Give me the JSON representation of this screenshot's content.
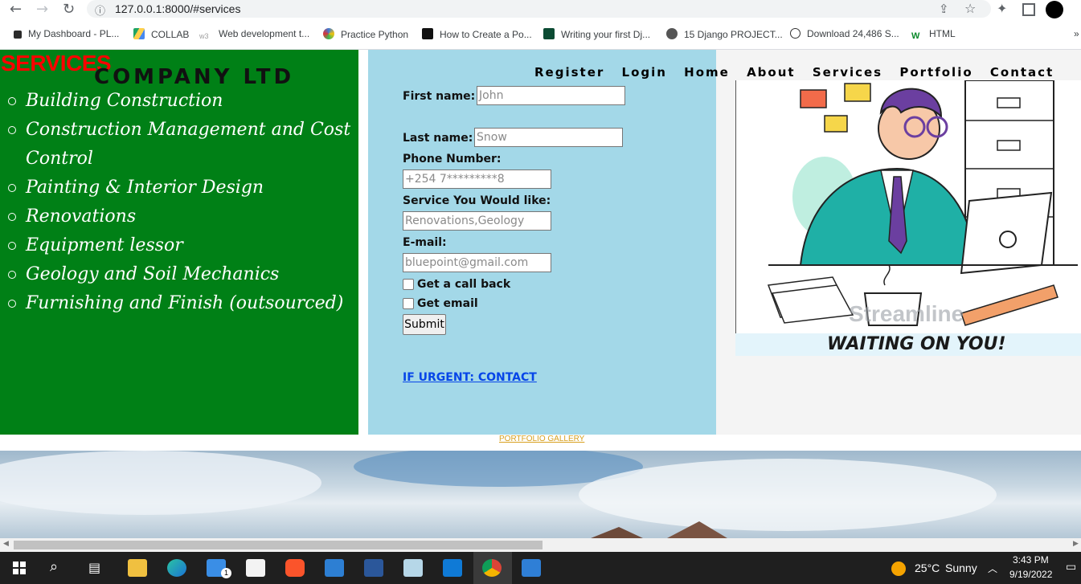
{
  "browser": {
    "url": "127.0.0.1:8000/#services",
    "bookmarks": [
      {
        "label": "My Dashboard - PL...",
        "color": "#2b2b2b"
      },
      {
        "label": "COLLAB",
        "color": "#1fa463"
      },
      {
        "label": "Web development t...",
        "color": "#9e9e9e"
      },
      {
        "label": "Practice Python",
        "color": "#3b7bd6"
      },
      {
        "label": "How to Create a Po...",
        "color": "#111111"
      },
      {
        "label": "Writing your first Dj...",
        "color": "#0c4b33"
      },
      {
        "label": "15 Django PROJECT...",
        "color": "#555555"
      },
      {
        "label": "Download 24,486 S...",
        "color": "#333333"
      },
      {
        "label": "HTML",
        "color": "#0a8a2a"
      }
    ],
    "more": "»"
  },
  "sidebar": {
    "title": "SERVICES",
    "company": "COMPANY LTD",
    "items": [
      "Building Construction",
      "Construction Management and Cost",
      "Control",
      "Painting & Interior Design",
      "Renovations",
      "Equipment lessor",
      "Geology and Soil Mechanics",
      "Furnishing and Finish (outsourced)"
    ]
  },
  "nav": [
    "Register",
    "Login",
    "Home",
    "About",
    "Services",
    "Portfolio",
    "Contact"
  ],
  "form": {
    "first_name_label": "First name:",
    "first_name_placeholder": "John",
    "last_name_label": "Last name:",
    "last_name_placeholder": "Snow",
    "phone_label": "Phone Number:",
    "phone_placeholder": "+254 7*********8",
    "service_label": "Service You Would like:",
    "service_placeholder": "Renovations,Geology",
    "email_label": "E-mail:",
    "email_placeholder": "bluepoint@gmail.com",
    "callback_label": "Get a call back",
    "getemail_label": "Get email",
    "submit_label": "Submit",
    "urgent_link": "IF URGENT: CONTACT"
  },
  "hero": {
    "watermark": "Streamline",
    "waiting_text": "WAITING ON YOU!"
  },
  "portfolio_link": "PORTFOLIO GALLERY",
  "taskbar": {
    "temperature": "25°C",
    "condition": "Sunny",
    "time": "3:43 PM",
    "date": "9/19/2022",
    "mail_badge": "1"
  }
}
